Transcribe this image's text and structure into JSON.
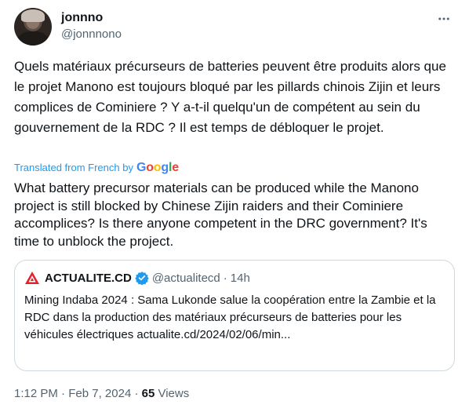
{
  "author": {
    "display_name": "jonnno",
    "handle": "@jonnnono"
  },
  "tweet": {
    "original_text": "Quels matériaux précurseurs de batteries peuvent être produits alors que le projet Manono est toujours bloqué par les pillards chinois Zijin et leurs complices de Cominiere ? Y a-t-il quelqu'un de compétent au sein du gouvernement de la RDC ? Il est temps de débloquer le projet.",
    "translated_label": "Translated from French by",
    "translator_logo": "Google",
    "translated_text": "What battery precursor materials can be produced while the Manono project is still blocked by Chinese Zijin raiders and their Cominiere accomplices? Is there anyone competent in the DRC government? It's time to unblock the project."
  },
  "quote": {
    "name": "ACTUALITE.CD",
    "handle": "@actualitecd",
    "separator": "·",
    "age": "14h",
    "text": "Mining Indaba 2024 : Sama Lukonde salue la coopération entre la Zambie et la RDC dans la production des matériaux précurseurs de batteries pour les véhicules électriques actualite.cd/2024/02/06/min..."
  },
  "footer": {
    "time": "1:12 PM",
    "separator": "·",
    "date": "Feb 7, 2024",
    "separator2": "·",
    "views_count": "65",
    "views_label": "Views"
  },
  "colors": {
    "text": "#0f1419",
    "secondary": "#536471",
    "link": "#1d9bf0",
    "border": "#cfd9de",
    "verified": "#1d9bf0",
    "brand_red": "#e0242b"
  },
  "icons": {
    "more": "more-horizontal-icon",
    "verified": "verified-badge-icon",
    "source_logo": "actualite-logo-icon"
  }
}
